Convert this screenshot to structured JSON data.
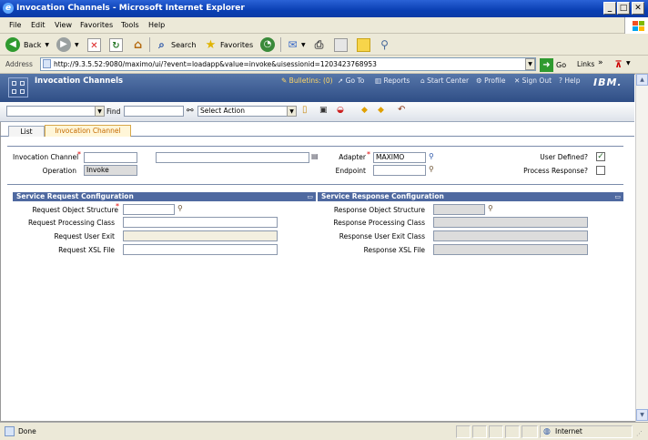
{
  "window": {
    "title": "Invocation Channels - Microsoft Internet Explorer"
  },
  "menu": {
    "items": [
      "File",
      "Edit",
      "View",
      "Favorites",
      "Tools",
      "Help"
    ]
  },
  "toolbar": {
    "back": "Back",
    "search": "Search",
    "favorites": "Favorites"
  },
  "address": {
    "label": "Address",
    "url": "http://9.3.5.52:9080/maximo/ui/?event=loadapp&value=invoke&uisessionid=1203423768953",
    "go": "Go",
    "links": "Links"
  },
  "maximo": {
    "app_title": "Invocation Channels",
    "links": {
      "bulletins": "Bulletins: (0)",
      "goto": "Go To",
      "reports": "Reports",
      "start_center": "Start Center",
      "profile": "Profile",
      "sign_out": "Sign Out",
      "help": "Help"
    },
    "brand": "IBM.",
    "find_label": "Find",
    "select_action": "Select Action"
  },
  "tabs": [
    "List",
    "Invocation Channel"
  ],
  "form": {
    "invocation_channel_label": "Invocation Channel",
    "operation_label": "Operation",
    "operation_value": "Invoke",
    "adapter_label": "Adapter",
    "adapter_value": "MAXIMO",
    "endpoint_label": "Endpoint",
    "user_defined_label": "User Defined?",
    "process_response_label": "Process Response?"
  },
  "request_section": {
    "title": "Service Request Configuration",
    "object_structure": "Request Object Structure",
    "processing_class": "Request Processing Class",
    "user_exit": "Request User Exit",
    "xsl_file": "Request XSL File"
  },
  "response_section": {
    "title": "Service Response Configuration",
    "object_structure": "Response Object Structure",
    "processing_class": "Response Processing Class",
    "user_exit_class": "Response User Exit Class",
    "xsl_file": "Response XSL File"
  },
  "status": {
    "left": "Done",
    "zone": "Internet"
  },
  "colors": {
    "titlebar": "#0a3fb3",
    "maximo_header": "#2f4e86",
    "section_bar": "#4f69a0",
    "active_tab": "#c46a00"
  }
}
